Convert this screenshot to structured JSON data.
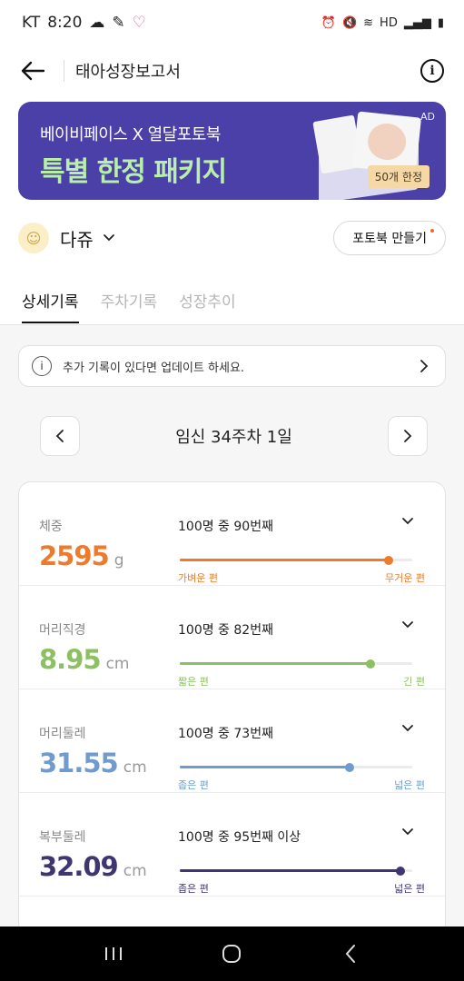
{
  "status_bar": {
    "carrier": "KT",
    "time": "8:20",
    "right_icons": [
      "alarm-icon",
      "mute-icon",
      "wifi-icon",
      "hd-icon",
      "signal-icon",
      "battery-icon"
    ],
    "hd_label": "HD"
  },
  "header": {
    "title": "태아성장보고서"
  },
  "banner": {
    "line1": "베이비페이스 X 열달포토북",
    "line2": "특별 한정 패키지",
    "ad_label": "AD",
    "tag": "50개 한정",
    "bg_color": "#4b3fa8",
    "accent_color": "#b8f0a8"
  },
  "profile": {
    "name": "다쥬",
    "photobook_button": "포토북 만들기"
  },
  "tabs": [
    {
      "label": "상세기록",
      "active": true
    },
    {
      "label": "주차기록",
      "active": false
    },
    {
      "label": "성장추이",
      "active": false
    }
  ],
  "notice": {
    "icon": "i",
    "text": "추가 기록이 있다면 업데이트 하세요."
  },
  "week_nav": {
    "label": "임신 34주차 1일"
  },
  "metrics": [
    {
      "label": "체중",
      "value": "2595",
      "unit": "g",
      "rank": "100명 중 90번째",
      "percent": 90,
      "left_label": "가벼운 편",
      "right_label": "무거운 편",
      "color": "#ee7a2c"
    },
    {
      "label": "머리직경",
      "value": "8.95",
      "unit": "cm",
      "rank": "100명 중 82번째",
      "percent": 82,
      "left_label": "짧은 편",
      "right_label": "긴 편",
      "color": "#8cc062"
    },
    {
      "label": "머리둘레",
      "value": "31.55",
      "unit": "cm",
      "rank": "100명 중 73번째",
      "percent": 73,
      "left_label": "좁은 편",
      "right_label": "넓은 편",
      "color": "#6f9ccd"
    },
    {
      "label": "복부둘레",
      "value": "32.09",
      "unit": "cm",
      "rank": "100명 중 95번째 이상",
      "percent": 95,
      "left_label": "좁은 편",
      "right_label": "넓은 편",
      "color": "#3f3570"
    }
  ]
}
